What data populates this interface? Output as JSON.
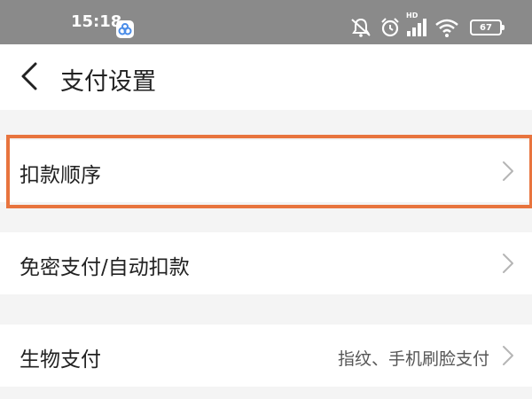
{
  "status_bar": {
    "time": "15:18",
    "battery": "67",
    "network_label": "HD",
    "icons": [
      "mute-icon",
      "alarm-icon",
      "signal-icon",
      "wifi-icon",
      "battery-icon"
    ]
  },
  "header": {
    "title": "支付设置"
  },
  "settings": {
    "items": [
      {
        "label": "扣款顺序",
        "value": ""
      },
      {
        "label": "免密支付/自动扣款",
        "value": ""
      },
      {
        "label": "生物支付",
        "value": "指纹、手机刷脸支付"
      }
    ]
  },
  "colors": {
    "highlight": "#e8743e",
    "status_bar": "#8a8a8a",
    "background": "#f4f4f4"
  }
}
